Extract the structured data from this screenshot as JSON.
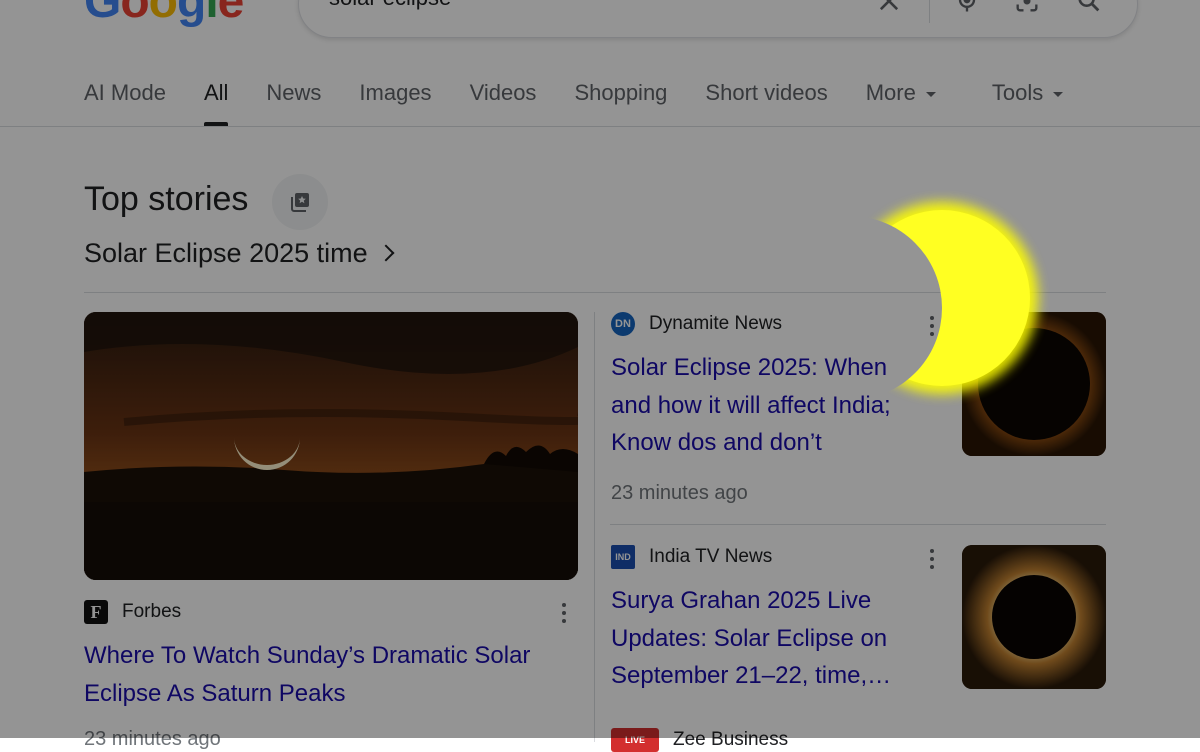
{
  "header": {
    "logo_text": "Google",
    "search": {
      "query": "solar eclipse"
    }
  },
  "tabs": [
    {
      "label": "AI Mode"
    },
    {
      "label": "All"
    },
    {
      "label": "News"
    },
    {
      "label": "Images"
    },
    {
      "label": "Videos"
    },
    {
      "label": "Shopping"
    },
    {
      "label": "Short videos"
    },
    {
      "label": "More"
    },
    {
      "label": "Tools"
    }
  ],
  "top_stories": {
    "title": "Top stories",
    "topic": "Solar Eclipse 2025 time",
    "lead": {
      "publisher": "Forbes",
      "publisher_logo_text": "F",
      "headline": "Where To Watch Sunday’s Dramatic Solar Eclipse As Saturn Peaks",
      "time": "23 minutes ago"
    },
    "stories": [
      {
        "publisher": "Dynamite News",
        "publisher_logo_text": "DN",
        "headline": "Solar Eclipse 2025: When and how it will affect India; Know dos and don’t",
        "time": "23 minutes ago"
      },
      {
        "publisher": "India TV News",
        "publisher_logo_text": "IND",
        "headline": "Surya Grahan 2025 Live Updates: Solar Eclipse on September 21–22, time,…"
      },
      {
        "publisher": "Zee Business",
        "publisher_logo_text": "LIVE"
      }
    ]
  },
  "overlay": {
    "accent_color": "#ffff00",
    "dim_color": "#000000"
  }
}
